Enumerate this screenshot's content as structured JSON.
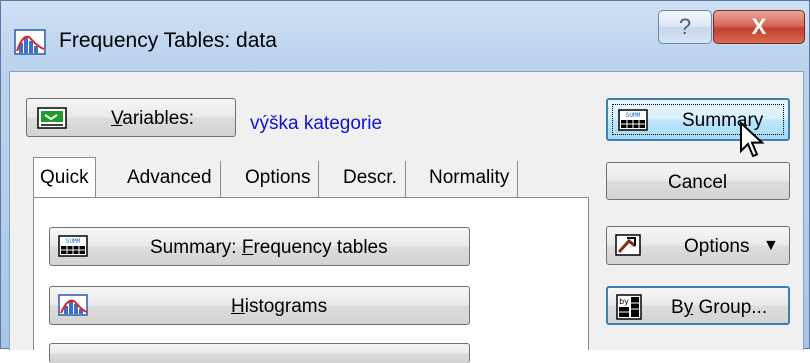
{
  "window": {
    "title": "Frequency Tables: data",
    "help_label": "?",
    "close_label": "X"
  },
  "variables": {
    "button_prefix": "V",
    "button_rest": "ariables:",
    "value": "výška kategorie"
  },
  "tabs": [
    {
      "label": "Quick",
      "active": true
    },
    {
      "label": "Advanced",
      "active": false
    },
    {
      "label": "Options",
      "active": false
    },
    {
      "label": "Descr.",
      "active": false
    },
    {
      "label": "Normality",
      "active": false
    }
  ],
  "quick": {
    "summary_prefix": "Summary:  ",
    "summary_u": "F",
    "summary_rest": "requency tables",
    "hist_u": "H",
    "hist_rest": "istograms"
  },
  "side": {
    "summary_label": "Summary",
    "cancel_label": "Cancel",
    "options_label": "Options",
    "options_arrow": "▼",
    "bygroup_pre": "B",
    "bygroup_u": "y",
    "bygroup_rest": " Group..."
  },
  "icons": {
    "summary_icon_text": "SUMM",
    "bygroup_icon_text": "by"
  },
  "colors": {
    "variable_value": "#1010d8",
    "close_button": "#c2402f",
    "title_bar": "#bcd3ee"
  }
}
